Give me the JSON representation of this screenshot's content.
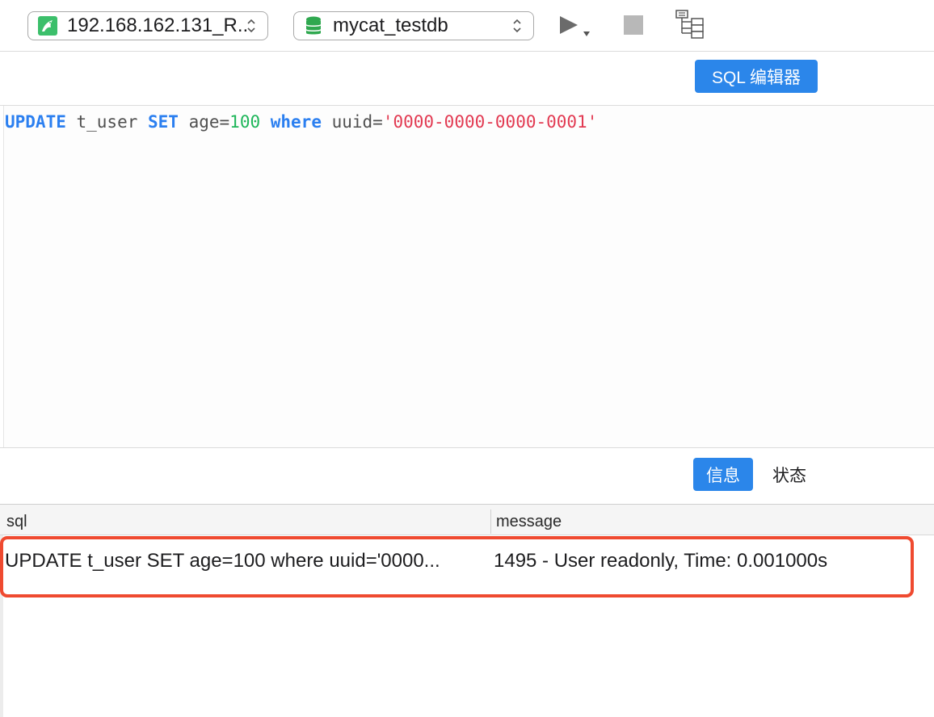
{
  "toolbar": {
    "connection_label": "192.168.162.131_R...",
    "database_label": "mycat_testdb",
    "icons": {
      "connection": "mysql-dolphin-icon",
      "database": "database-stack-icon",
      "run": "play-icon",
      "stop": "stop-icon",
      "explain": "explain-tree-icon"
    }
  },
  "editor": {
    "tab_label": "SQL 编辑器",
    "code": {
      "kw_update": "UPDATE",
      "table": " t_user ",
      "kw_set": "SET",
      "assign": " age=",
      "value": "100",
      "kw_where": " where",
      "cond": " uuid=",
      "str": "'0000-0000-0000-0001'"
    }
  },
  "results": {
    "tabs": [
      {
        "label": "信息",
        "active": true
      },
      {
        "label": "状态",
        "active": false
      }
    ],
    "columns": [
      "sql",
      "message"
    ],
    "rows": [
      {
        "sql": "UPDATE t_user SET age=100 where uuid='0000...",
        "message": "1495 - User readonly, Time: 0.001000s"
      }
    ]
  },
  "colors": {
    "accent": "#2b86ea",
    "keyword": "#2b7ff0",
    "number": "#1fb65a",
    "string": "#e23a52",
    "highlight": "#ef4a30"
  }
}
